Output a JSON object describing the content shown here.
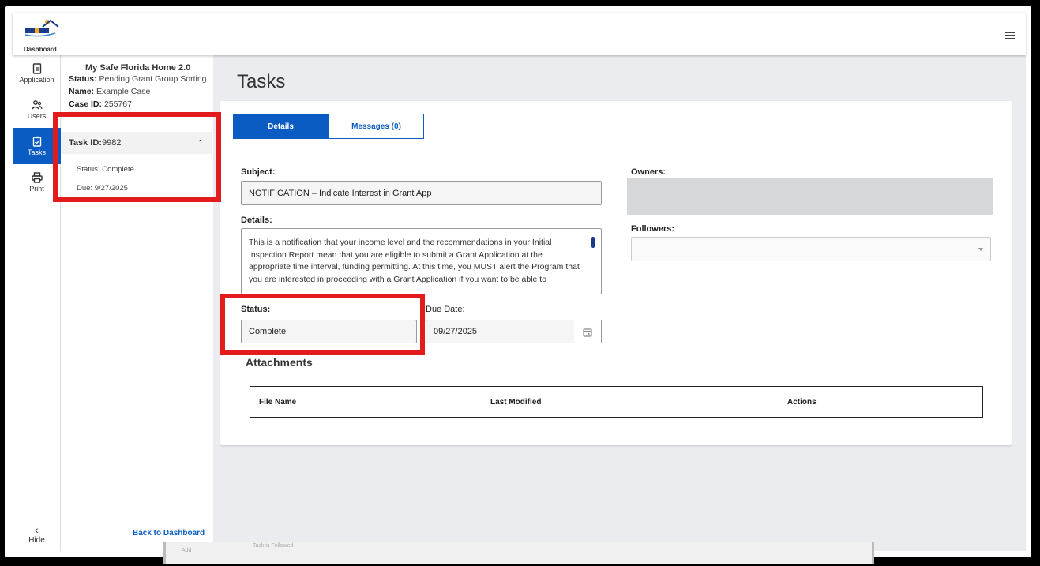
{
  "header": {
    "logo_alt": "My Safe Florida Home",
    "logo_label": "Dashboard"
  },
  "nav": {
    "items": [
      {
        "label": "Application",
        "icon": "document-icon"
      },
      {
        "label": "Users",
        "icon": "users-icon"
      },
      {
        "label": "Tasks",
        "icon": "tasks-icon",
        "active": true
      },
      {
        "label": "Print",
        "icon": "printer-icon"
      }
    ],
    "hide_label": "Hide"
  },
  "case": {
    "title": "My Safe Florida Home 2.0",
    "status_label": "Status:",
    "status_value": "Pending Grant Group Sorting",
    "name_label": "Name:",
    "name_value": "Example Case",
    "caseid_label": "Case ID:",
    "caseid_value": "255767"
  },
  "task_card": {
    "id_label": "Task ID:",
    "id_value": "9982",
    "status_line": "Status: Complete",
    "due_line": "Due: 9/27/2025"
  },
  "back_link": "Back to Dashboard",
  "page_title": "Tasks",
  "tabs": [
    {
      "label": "Details",
      "active": true
    },
    {
      "label": "Messages (0)",
      "active": false
    }
  ],
  "form": {
    "subject_label": "Subject:",
    "subject_value": "NOTIFICATION – Indicate Interest in Grant App",
    "details_label": "Details:",
    "details_value": "This is a notification that your income level and the recommendations in your Initial Inspection Report mean that you are eligible to submit a Grant Application at the appropriate time interval, funding permitting. At this time, you MUST alert the Program that you are interested in proceeding with a Grant Application if you want to be able to",
    "status_label": "Status:",
    "status_value": "Complete",
    "due_label": "Due Date:",
    "due_value": "09/27/2025",
    "owners_label": "Owners:",
    "followers_label": "Followers:"
  },
  "attachments": {
    "title": "Attachments",
    "columns": [
      "File Name",
      "Last Modified",
      "Actions"
    ]
  },
  "ghost": {
    "text1": "Task is Followed",
    "text2": "Add"
  },
  "colors": {
    "accent": "#0b5cc2",
    "highlight": "#e21c1c"
  }
}
